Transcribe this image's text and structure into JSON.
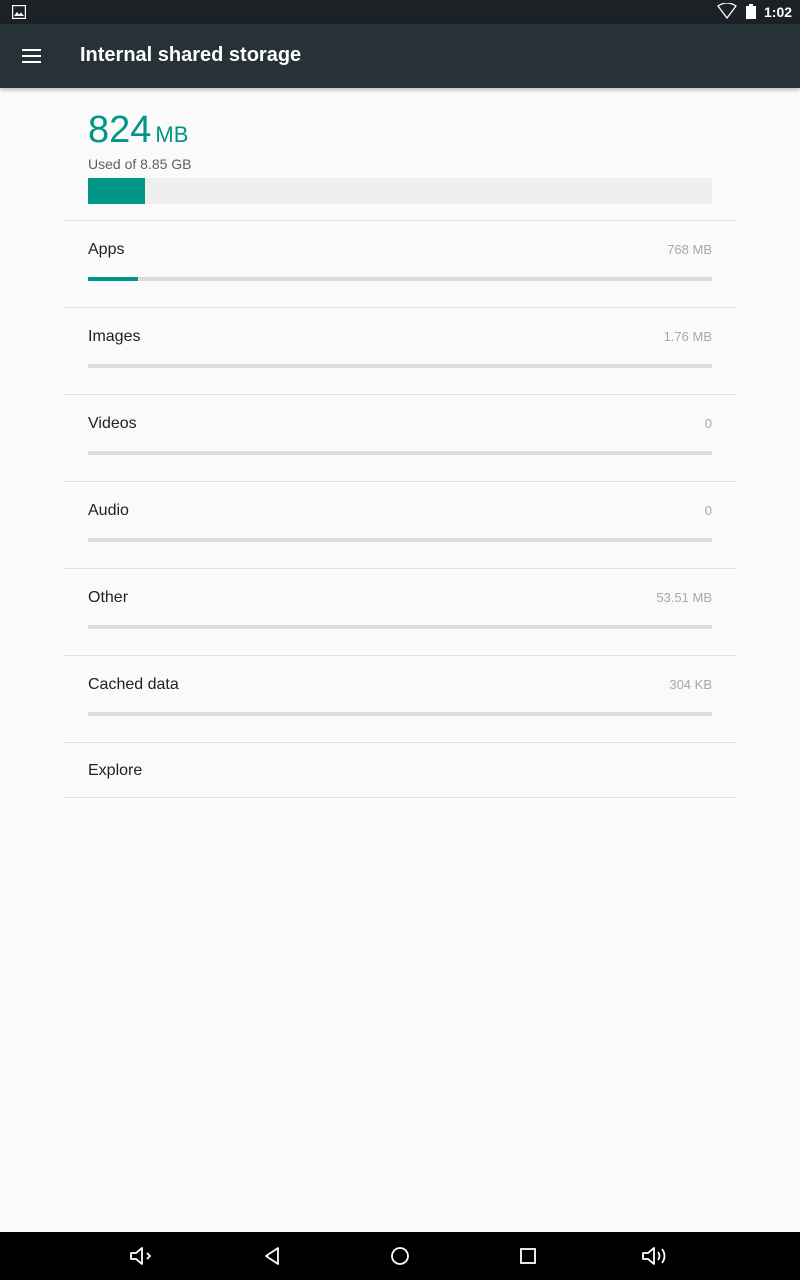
{
  "status_bar": {
    "time": "1:02",
    "icons": [
      "image-icon",
      "wifi-icon",
      "battery-icon"
    ]
  },
  "app_bar": {
    "title": "Internal shared storage",
    "menu_icon": "hamburger-menu-icon"
  },
  "summary": {
    "used_value": "824",
    "used_unit": "MB",
    "caption": "Used of 8.85 GB",
    "used_fraction": 0.091
  },
  "categories": [
    {
      "label": "Apps",
      "size": "768 MB",
      "fraction": 0.08
    },
    {
      "label": "Images",
      "size": "1.76 MB",
      "fraction": 0
    },
    {
      "label": "Videos",
      "size": "0",
      "fraction": 0
    },
    {
      "label": "Audio",
      "size": "0",
      "fraction": 0
    },
    {
      "label": "Other",
      "size": "53.51 MB",
      "fraction": 0
    },
    {
      "label": "Cached data",
      "size": "304 KB",
      "fraction": 0
    }
  ],
  "explore": {
    "label": "Explore"
  },
  "nav_bar": {
    "buttons": [
      "volume-down-icon",
      "back-icon",
      "home-icon",
      "recents-icon",
      "volume-up-icon"
    ]
  },
  "colors": {
    "accent": "#009688",
    "app_bar": "#263238",
    "status_bar": "#1c2125",
    "background": "#fafafa"
  }
}
